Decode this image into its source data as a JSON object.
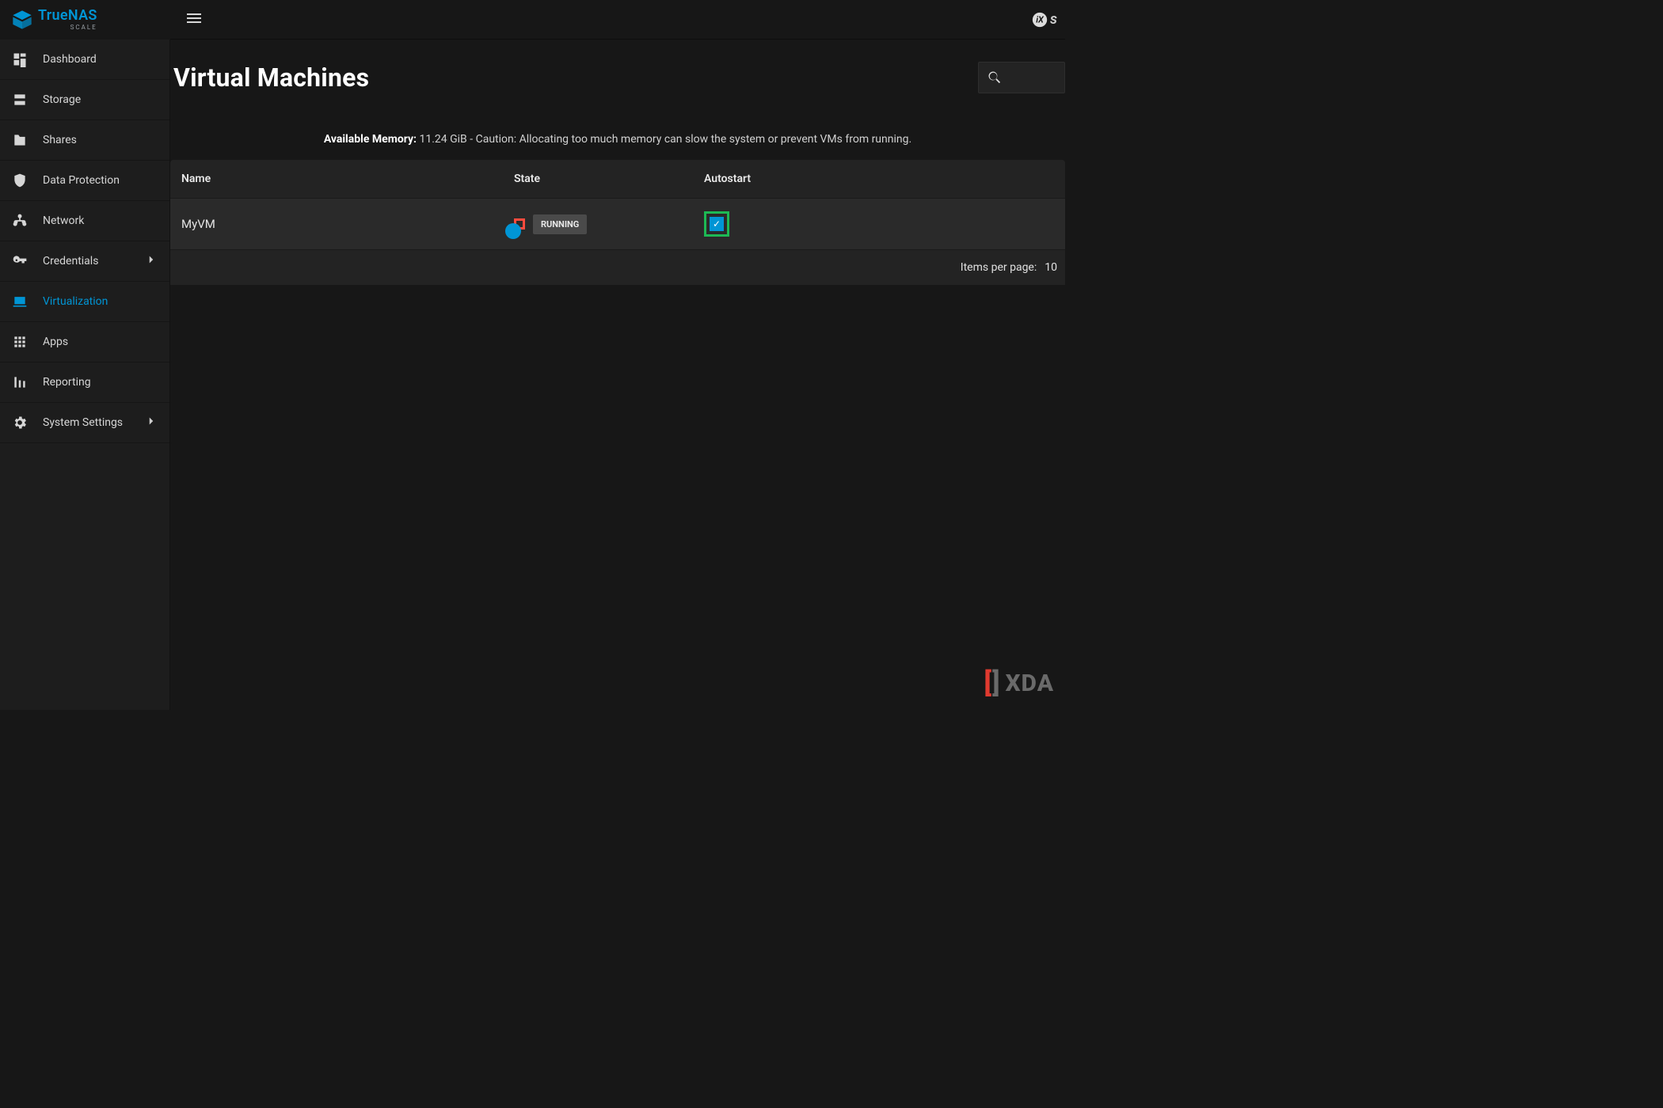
{
  "brand": {
    "primary": "True",
    "secondary": "NAS",
    "sub": "SCALE"
  },
  "partner_logo": "iXsystems",
  "sidebar": {
    "items": [
      {
        "label": "Dashboard",
        "icon": "dashboard",
        "active": false,
        "expandable": false
      },
      {
        "label": "Storage",
        "icon": "storage",
        "active": false,
        "expandable": false
      },
      {
        "label": "Shares",
        "icon": "folder",
        "active": false,
        "expandable": false
      },
      {
        "label": "Data Protection",
        "icon": "shield",
        "active": false,
        "expandable": false
      },
      {
        "label": "Network",
        "icon": "network",
        "active": false,
        "expandable": false
      },
      {
        "label": "Credentials",
        "icon": "key",
        "active": false,
        "expandable": true
      },
      {
        "label": "Virtualization",
        "icon": "laptop",
        "active": true,
        "expandable": false
      },
      {
        "label": "Apps",
        "icon": "apps",
        "active": false,
        "expandable": false
      },
      {
        "label": "Reporting",
        "icon": "chart",
        "active": false,
        "expandable": false
      },
      {
        "label": "System Settings",
        "icon": "gear",
        "active": false,
        "expandable": true
      }
    ]
  },
  "page_title": "Virtual Machines",
  "memory": {
    "label": "Available Memory:",
    "value": "11.24 GiB",
    "warning": "- Caution: Allocating too much memory can slow the system or prevent VMs from running."
  },
  "table": {
    "headers": {
      "name": "Name",
      "state": "State",
      "autostart": "Autostart"
    },
    "rows": [
      {
        "name": "MyVM",
        "state_label": "RUNNING",
        "state_on": true,
        "autostart": true,
        "state_highlight_color": "#ff4b3e",
        "autostart_highlight_color": "#1db954"
      }
    ],
    "footer": {
      "items_per_page_label": "Items per page:",
      "items_per_page_value": "10"
    }
  },
  "watermark": "XDA",
  "colors": {
    "accent": "#0095d5",
    "bg": "#171717",
    "card": "#232323"
  }
}
